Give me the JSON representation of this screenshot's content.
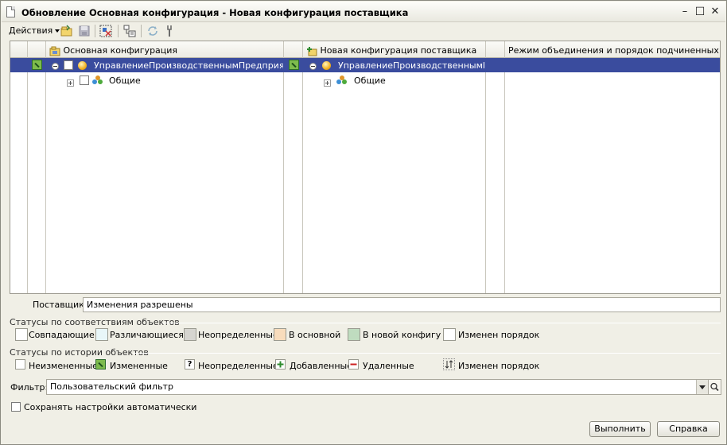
{
  "window": {
    "title": "Обновление Основная конфигурация - Новая конфигурация поставщика"
  },
  "toolbar": {
    "actions_label": "Действия"
  },
  "tree": {
    "columns": [
      "Основная конфигурация",
      "Новая конфигурация поставщика",
      "Режим объединения и порядок подчиненных объе..."
    ],
    "rows": [
      {
        "main": "УправлениеПроизводственнымПредприяти...",
        "vendor": "УправлениеПроизводственнымП..."
      },
      {
        "main": "Общие",
        "vendor": "Общие"
      }
    ]
  },
  "supplier": {
    "label": "Поставщик:",
    "value": "Изменения разрешены"
  },
  "status_match": {
    "title": "Статусы по соответствиям объектов",
    "items": [
      {
        "label": "Совпадающие",
        "color": "#ffffff"
      },
      {
        "label": "Различающиеся",
        "color": "#e8f6f8"
      },
      {
        "label": "Неопределенные",
        "color": "#d6d5d0"
      },
      {
        "label": "В основной",
        "color": "#f8dcbc"
      },
      {
        "label": "В новой конфигур...",
        "color": "#bfdcbf"
      },
      {
        "label": "Изменен порядок",
        "color": "#ffffff"
      }
    ]
  },
  "status_history": {
    "title": "Статусы по истории объектов",
    "items": [
      {
        "label": "Неизмененные",
        "icon": "blank-icon"
      },
      {
        "label": "Измененные",
        "icon": "edited-icon"
      },
      {
        "label": "Неопределенные",
        "icon": "question-icon"
      },
      {
        "label": "Добавленные",
        "icon": "added-icon"
      },
      {
        "label": "Удаленные",
        "icon": "removed-icon"
      },
      {
        "label": "Изменен порядок",
        "icon": "order-icon"
      }
    ]
  },
  "filter": {
    "label": "Фильтр:",
    "value": "Пользовательский фильтр"
  },
  "autosave": {
    "label": "Сохранять настройки автоматически"
  },
  "buttons": {
    "execute": "Выполнить",
    "help": "Справка"
  }
}
